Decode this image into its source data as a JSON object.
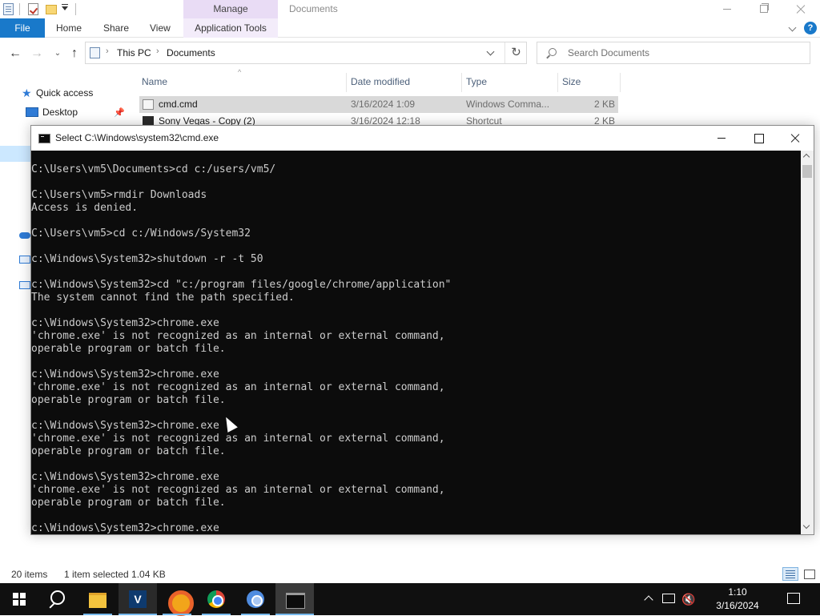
{
  "explorer": {
    "window_title": "Documents",
    "manage_tab": "Manage",
    "ribbon": {
      "file": "File",
      "home": "Home",
      "share": "Share",
      "view": "View",
      "application_tools": "Application Tools",
      "help": "?"
    },
    "address": {
      "crumbs": [
        "This PC",
        "Documents"
      ],
      "separator": "›"
    },
    "search": {
      "placeholder": "Search Documents"
    },
    "nav_pane": {
      "quick_access": "Quick access",
      "desktop": "Desktop"
    },
    "columns": {
      "name": "Name",
      "date_modified": "Date modified",
      "type": "Type",
      "size": "Size"
    },
    "files": [
      {
        "name": "cmd.cmd",
        "date": "3/16/2024 1:09",
        "type": "Windows Comma...",
        "size": "2 KB",
        "selected": true
      },
      {
        "name": "Sony Vegas - Copy (2)",
        "date": "3/16/2024 12:18",
        "type": "Shortcut",
        "size": "2 KB",
        "selected": false
      }
    ],
    "status": {
      "count": "20 items",
      "selected": "1 item selected  1.04 KB"
    }
  },
  "cmd": {
    "title": "Select C:\\Windows\\system32\\cmd.exe",
    "lines": [
      "C:\\Users\\vm5\\Documents>cd c:/users/vm5/",
      "",
      "C:\\Users\\vm5>rmdir Downloads",
      "Access is denied.",
      "",
      "C:\\Users\\vm5>cd c:/Windows/System32",
      "",
      "c:\\Windows\\System32>shutdown -r -t 50",
      "",
      "c:\\Windows\\System32>cd \"c:/program files/google/chrome/application\"",
      "The system cannot find the path specified.",
      "",
      "c:\\Windows\\System32>chrome.exe",
      "'chrome.exe' is not recognized as an internal or external command,",
      "operable program or batch file.",
      "",
      "c:\\Windows\\System32>chrome.exe",
      "'chrome.exe' is not recognized as an internal or external command,",
      "operable program or batch file.",
      "",
      "c:\\Windows\\System32>chrome.exe",
      "'chrome.exe' is not recognized as an internal or external command,",
      "operable program or batch file.",
      "",
      "c:\\Windows\\System32>chrome.exe",
      "'chrome.exe' is not recognized as an internal or external command,",
      "operable program or batch file.",
      "",
      "c:\\Windows\\System32>chrome.exe"
    ]
  },
  "taskbar": {
    "clock_time": "1:10",
    "clock_date": "3/16/2024"
  },
  "colors": {
    "accent": "#1979ca",
    "manage_tab": "#e9dcf5",
    "selection": "#d9d9d9",
    "console_bg": "#0c0c0c",
    "console_text": "#cccccc",
    "taskbar": "#101010"
  }
}
